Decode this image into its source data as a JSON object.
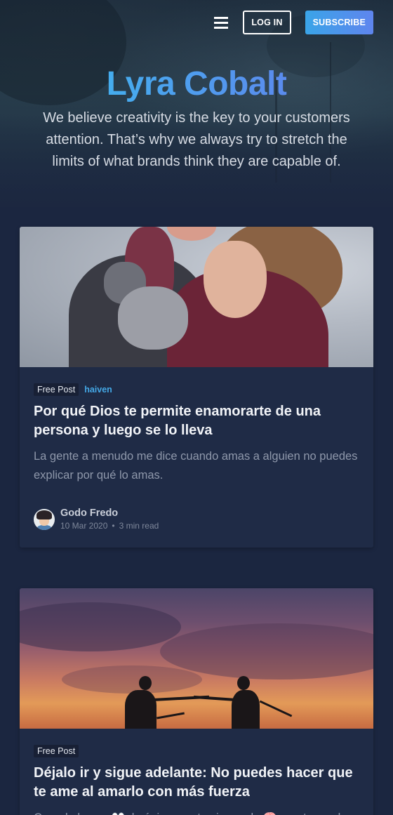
{
  "header": {
    "login_label": "LOG IN",
    "subscribe_label": "SUBSCRIBE",
    "site_title": "Lyra Cobalt",
    "site_description": "We believe creativity is the key to your customers attention. That’s why we always try to stretch the limits of what brands think they are capable of."
  },
  "posts": [
    {
      "tag": "Free Post",
      "category": "haiven",
      "title": "Por qué Dios te permite enamorarte de una persona y luego se lo lleva",
      "excerpt": "La gente a menudo me dice cuando amas a alguien no puedes explicar por qué lo amas.",
      "author": "Godo Fredo",
      "date": "10 Mar 2020",
      "reading_time": "3 min read"
    },
    {
      "tag": "Free Post",
      "title": "Déjalo ir y sigue adelante: No puedes hacer que te ame al amarlo con más fuerza",
      "excerpt": "Cuando lo ves 👀, lo único que te viene a la 🧠 mente es el"
    }
  ],
  "colors": {
    "background": "#1b2640",
    "card": "#1f2b46",
    "accent": "#44a8e6",
    "subscribe_gradient_start": "#3aa4e8",
    "subscribe_gradient_end": "#5f85ee"
  },
  "icons": {
    "menu": "hamburger-menu-icon"
  }
}
